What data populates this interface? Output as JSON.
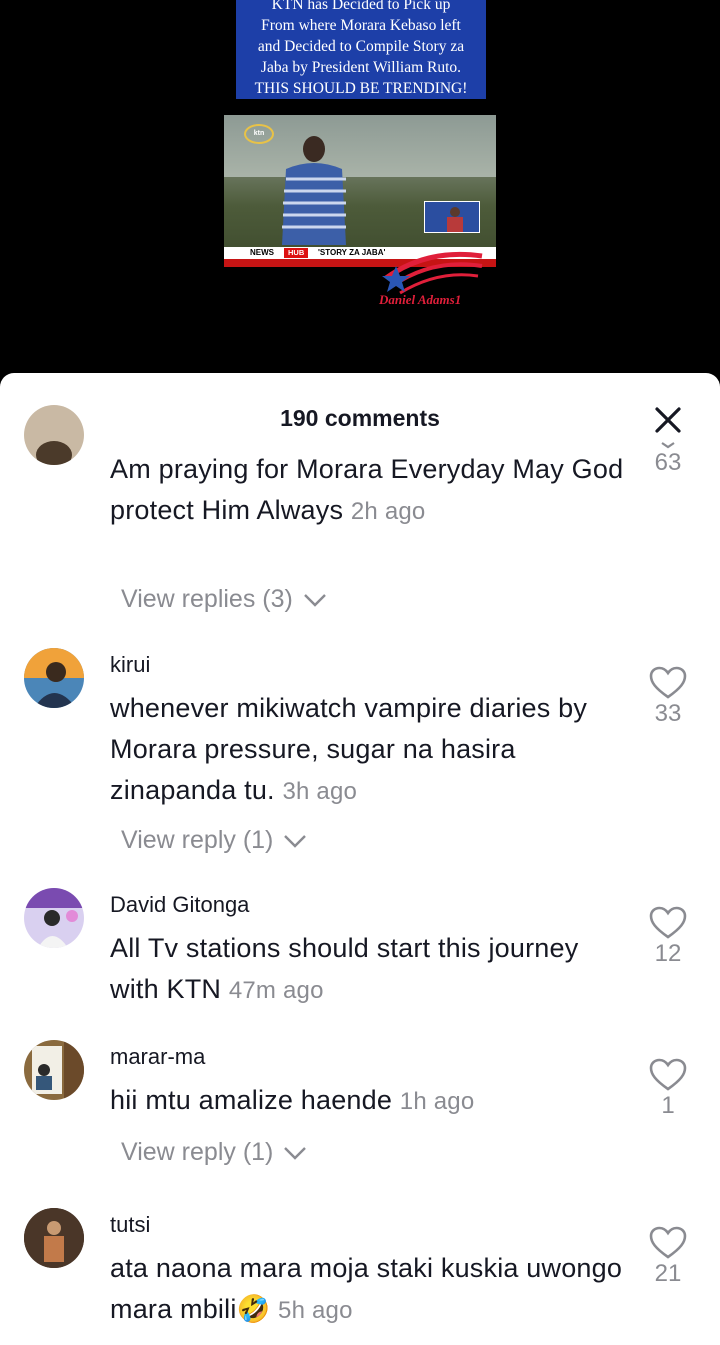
{
  "video": {
    "caption_lines": [
      "KTN has Decided to Pick up",
      "From where Morara Kebaso left",
      "and Decided to Compile Story za",
      "Jaba by President William Ruto.",
      "THIS SHOULD BE TRENDING!"
    ],
    "thumbnail": {
      "logo": "ktn",
      "ticker_news": "NEWS",
      "ticker_hub": "HUB",
      "ticker_story": "'STORY ZA JABA'"
    },
    "watermark": "Daniel Adams1"
  },
  "comments_panel": {
    "title": "190 comments",
    "close_icon": "close-icon",
    "comments": [
      {
        "username": "",
        "text": "Am praying for Morara Everyday May God protect Him Always",
        "time": "2h ago",
        "likes": "63",
        "replies_label": "View replies (3)"
      },
      {
        "username": "kirui",
        "text": "whenever mikiwatch vampire diaries by Morara pressure, sugar na hasira zinapanda tu.",
        "time": "3h ago",
        "likes": "33",
        "replies_label": "View reply (1)"
      },
      {
        "username": "David Gitonga",
        "text": "All Tv stations should start this journey with KTN",
        "time": "47m ago",
        "likes": "12",
        "replies_label": ""
      },
      {
        "username": "marar-ma",
        "text": "hii mtu amalize haende",
        "time": "1h ago",
        "likes": "1",
        "replies_label": "View reply (1)"
      },
      {
        "username": "tutsi",
        "text": "ata naona mara moja staki kuskia uwongo mara mbili🤣",
        "time": "5h ago",
        "likes": "21",
        "replies_label": ""
      }
    ]
  },
  "colors": {
    "caption_bg": "#1d3fa8",
    "secondary_text": "#8a8b91",
    "primary_text": "#161823",
    "watermark": "#e01f3a"
  }
}
